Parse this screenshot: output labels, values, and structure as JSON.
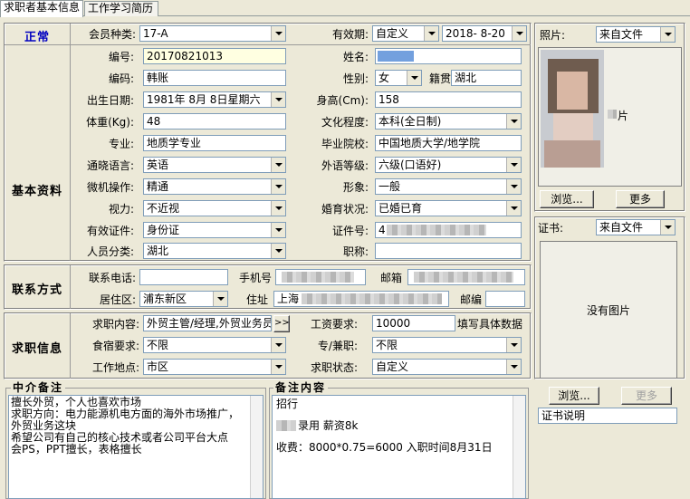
{
  "tabs": [
    "求职者基本信息",
    "工作学习简历"
  ],
  "status": "正常",
  "member": {
    "label": "会员种类:",
    "value": "17-A"
  },
  "validity": {
    "label": "有效期:",
    "mode": "自定义",
    "date": "2018- 8-20"
  },
  "sections": {
    "basic": "基本资料",
    "contact": "联系方式",
    "job": "求职信息"
  },
  "basic": {
    "id": {
      "label": "编号:",
      "value": "20170821013"
    },
    "name": {
      "label": "姓名:"
    },
    "code": {
      "label": "编码:",
      "value": "韩账"
    },
    "gender": {
      "label": "性别:",
      "value": "女"
    },
    "native": {
      "label": "籍贯",
      "value": "湖北"
    },
    "birth": {
      "label": "出生日期:",
      "value": "1981年 8月 8日星期六"
    },
    "height": {
      "label": "身高(Cm):",
      "value": "158"
    },
    "weight": {
      "label": "体重(Kg):",
      "value": "48"
    },
    "education": {
      "label": "文化程度:",
      "value": "本科(全日制)"
    },
    "major": {
      "label": "专业:",
      "value": "地质学专业"
    },
    "school": {
      "label": "毕业院校:",
      "value": "中国地质大学/地学院"
    },
    "language": {
      "label": "通晓语言:",
      "value": "英语"
    },
    "foreign": {
      "label": "外语等级:",
      "value": "六级(口语好)"
    },
    "computer": {
      "label": "微机操作:",
      "value": "精通"
    },
    "image": {
      "label": "形象:",
      "value": "一般"
    },
    "vision": {
      "label": "视力:",
      "value": "不近视"
    },
    "marriage": {
      "label": "婚育状况:",
      "value": "已婚已育"
    },
    "cert_type": {
      "label": "有效证件:",
      "value": "身份证"
    },
    "cert_no": {
      "label": "证件号:",
      "value": "4"
    },
    "category": {
      "label": "人员分类:",
      "value": "湖北"
    },
    "title": {
      "label": "职称:",
      "value": ""
    }
  },
  "contact": {
    "phone": {
      "label": "联系电话:",
      "value": ""
    },
    "mobile": {
      "label": "手机号"
    },
    "email": {
      "label": "邮箱"
    },
    "district": {
      "label": "居住区:",
      "value": "浦东新区"
    },
    "address": {
      "label": "住址",
      "value": "上海"
    },
    "zip": {
      "label": "邮编",
      "value": ""
    }
  },
  "job": {
    "content": {
      "label": "求职内容:",
      "value": "外贸主管/经理,外贸业务员",
      "more": ">>"
    },
    "salary": {
      "label": "工资要求:",
      "value": "10000",
      "hint": "填写具体数据"
    },
    "lodging": {
      "label": "食宿要求:",
      "value": "不限"
    },
    "parttime": {
      "label": "专/兼职:",
      "value": "不限"
    },
    "location": {
      "label": "工作地点:",
      "value": "市区"
    },
    "jobstatus": {
      "label": "求职状态:",
      "value": "自定义"
    }
  },
  "agent_notes": {
    "title": "中介备注",
    "lines": [
      "擅长外贸，个人也喜欢市场",
      "求职方向：电力能源机电方面的海外市场推广，",
      "外贸业务这块",
      "希望公司有自己的核心技术或者公司平台大点",
      "会PS，PPT擅长，表格擅长"
    ]
  },
  "remarks": {
    "title": "备注内容",
    "line1": "招行",
    "line2": "录用 薪资8k",
    "line3": "收费：8000*0.75=6000 入职时间8月31日"
  },
  "photo": {
    "label": "照片:",
    "source": "来自文件",
    "caption": "片",
    "browse": "浏览...",
    "more": "更多"
  },
  "certificate": {
    "label": "证书:",
    "source": "来自文件",
    "empty": "没有图片",
    "browse": "浏览...",
    "more": "更多",
    "desc": "证书说明"
  }
}
